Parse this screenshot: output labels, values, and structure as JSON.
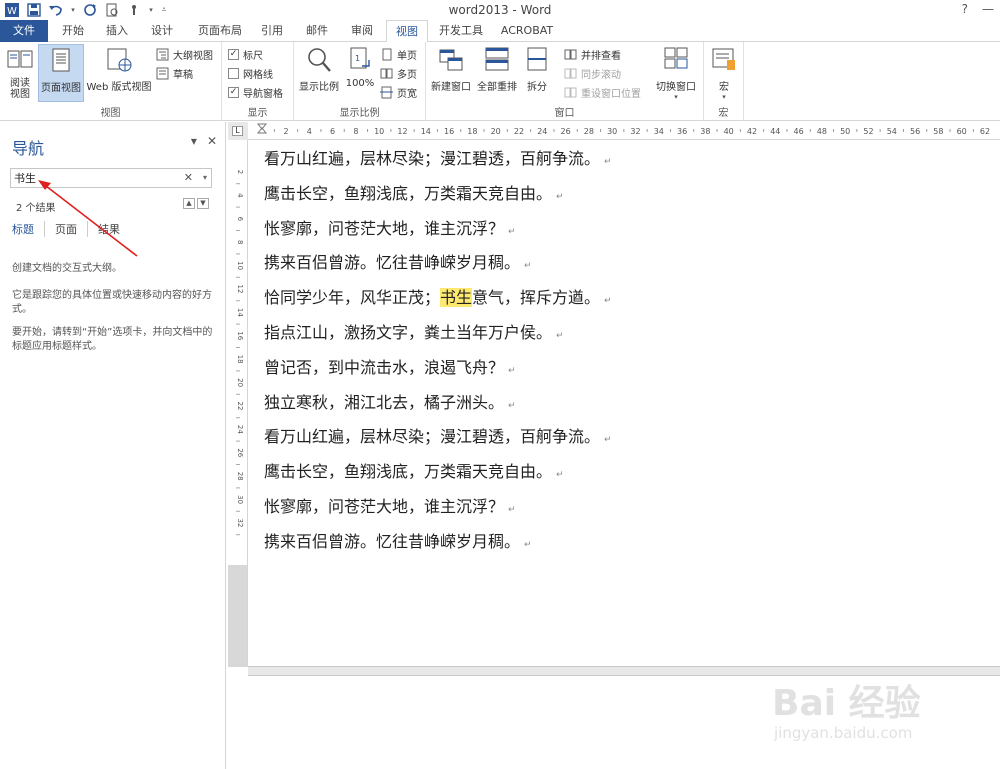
{
  "window": {
    "title": "word2013 - Word",
    "help": "?",
    "minimize": "—",
    "close": "✕"
  },
  "tabs": [
    "文件",
    "开始",
    "插入",
    "设计",
    "页面布局",
    "引用",
    "邮件",
    "审阅",
    "视图",
    "开发工具",
    "ACROBAT"
  ],
  "active_tab": "视图",
  "ribbon": {
    "views": {
      "label": "视图",
      "reading": "阅读\n视图",
      "print": "页面视图",
      "web": "Web 版式视图",
      "outline": "大纲视图",
      "draft": "草稿"
    },
    "show": {
      "label": "显示",
      "ruler": "标尺",
      "gridlines": "网格线",
      "navpane": "导航窗格"
    },
    "zoom": {
      "label": "显示比例",
      "zoom": "显示比例",
      "hundred": "100%",
      "onepage": "单页",
      "multipage": "多页",
      "pagewidth": "页宽"
    },
    "window": {
      "label": "窗口",
      "newwin": "新建窗口",
      "arrange": "全部重排",
      "split": "拆分",
      "sidebyside": "并排查看",
      "syncscroll": "同步滚动",
      "reset": "重设窗口位置",
      "switch": "切换窗口"
    },
    "macros": {
      "label": "宏",
      "macros": "宏"
    }
  },
  "nav": {
    "title": "导航",
    "search_value": "书生",
    "results": "2 个结果",
    "tabs": [
      "标题",
      "页面",
      "结果"
    ],
    "active_tab": "标题",
    "text1": "创建文档的交互式大纲。",
    "text2": "它是跟踪您的具体位置或快速移动内容的好方式。",
    "text3": "要开始，请转到“开始”选项卡，并向文档中的标题应用标题样式。"
  },
  "ruler_h": [
    "2",
    "4",
    "6",
    "8",
    "10",
    "12",
    "14",
    "16",
    "18",
    "20",
    "22",
    "24",
    "26",
    "28",
    "30",
    "32",
    "34",
    "36",
    "38",
    "40",
    "42",
    "44",
    "46",
    "48",
    "50",
    "52",
    "54",
    "56",
    "58",
    "60",
    "62"
  ],
  "ruler_v": [
    "2",
    "4",
    "6",
    "8",
    "10",
    "12",
    "14",
    "16",
    "18",
    "20",
    "22",
    "24",
    "26",
    "28",
    "30",
    "32"
  ],
  "doc": {
    "lines": [
      {
        "pre": "看万山红遍，层林尽染；漫江碧透，百舸争流。"
      },
      {
        "pre": "鹰击长空，鱼翔浅底，万类霜天竞自由。"
      },
      {
        "pre": "怅寥廓，问苍茫大地，谁主沉浮？"
      },
      {
        "pre": "携来百侣曾游。忆往昔峥嵘岁月稠。"
      },
      {
        "pre": "恰同学少年，风华正茂；",
        "hl": "书生",
        "post": "意气，挥斥方遒。"
      },
      {
        "pre": "指点江山，激扬文字，粪土当年万户侯。"
      },
      {
        "pre": "曾记否，到中流击水，浪遏飞舟？"
      },
      {
        "pre": "独立寒秋，湘江北去，橘子洲头。"
      },
      {
        "pre": "看万山红遍，层林尽染；漫江碧透，百舸争流。"
      },
      {
        "pre": "鹰击长空，鱼翔浅底，万类霜天竞自由。"
      },
      {
        "pre": "怅寥廓，问苍茫大地，谁主沉浮？"
      },
      {
        "pre": "携来百侣曾游。忆往昔峥嵘岁月稠。"
      }
    ],
    "para_mark": "↵"
  },
  "watermark": {
    "main": "Bai 经验",
    "sub": "jingyan.baidu.com"
  }
}
